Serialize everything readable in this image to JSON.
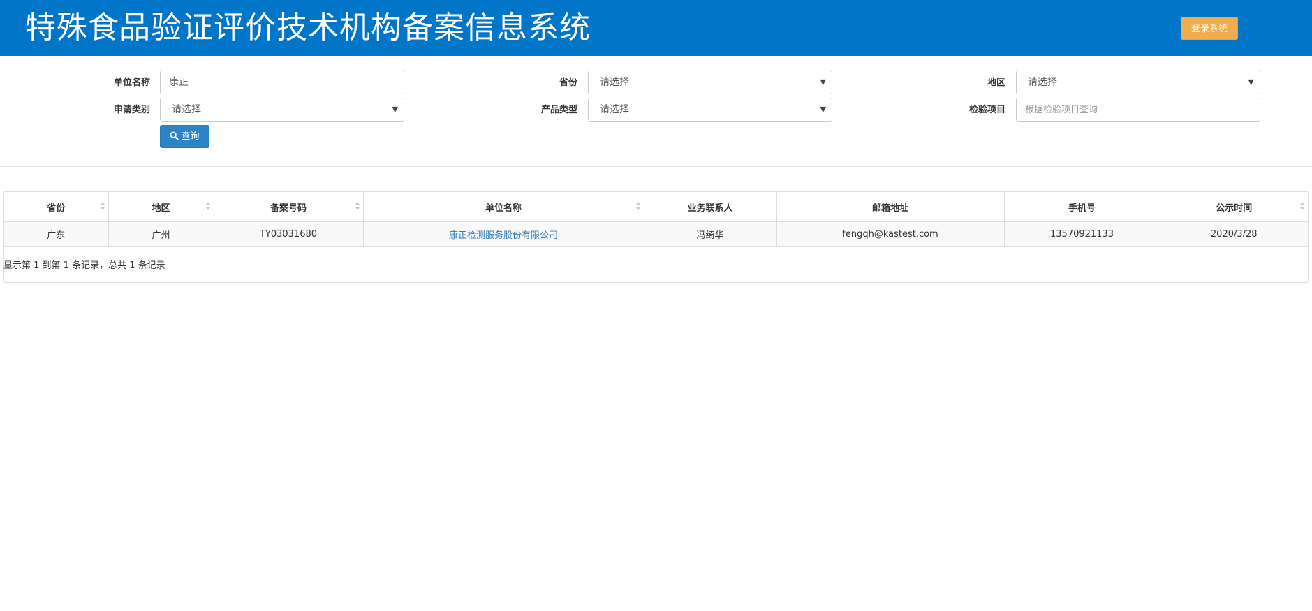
{
  "header": {
    "title": "特殊食品验证评价技术机构备案信息系统",
    "login_label": "登录系统"
  },
  "search": {
    "unit_name_label": "单位名称",
    "unit_name_value": "康正",
    "province_label": "省份",
    "province_value": "请选择",
    "region_label": "地区",
    "region_value": "请选择",
    "apply_type_label": "申请类别",
    "apply_type_value": "请选择",
    "product_type_label": "产品类型",
    "product_type_value": "请选择",
    "test_item_label": "检验项目",
    "test_item_placeholder": "根据检验项目查询",
    "query_label": "查询"
  },
  "table": {
    "columns": [
      "省份",
      "地区",
      "备案号码",
      "单位名称",
      "业务联系人",
      "邮箱地址",
      "手机号",
      "公示时间"
    ],
    "rows": [
      [
        "广东",
        "广州",
        "TY03031680",
        "康正检测服务股份有限公司",
        "冯绮华",
        "fengqh@kastest.com",
        "13570921133",
        "2020/3/28"
      ]
    ]
  },
  "pagination": {
    "info": "显示第 1 到第 1 条记录，总共 1 条记录"
  },
  "colors": {
    "header_bg": "#0175c8",
    "login_bg": "#f0ad4e",
    "query_bg": "#2c84c7",
    "link": "#337ab7"
  }
}
